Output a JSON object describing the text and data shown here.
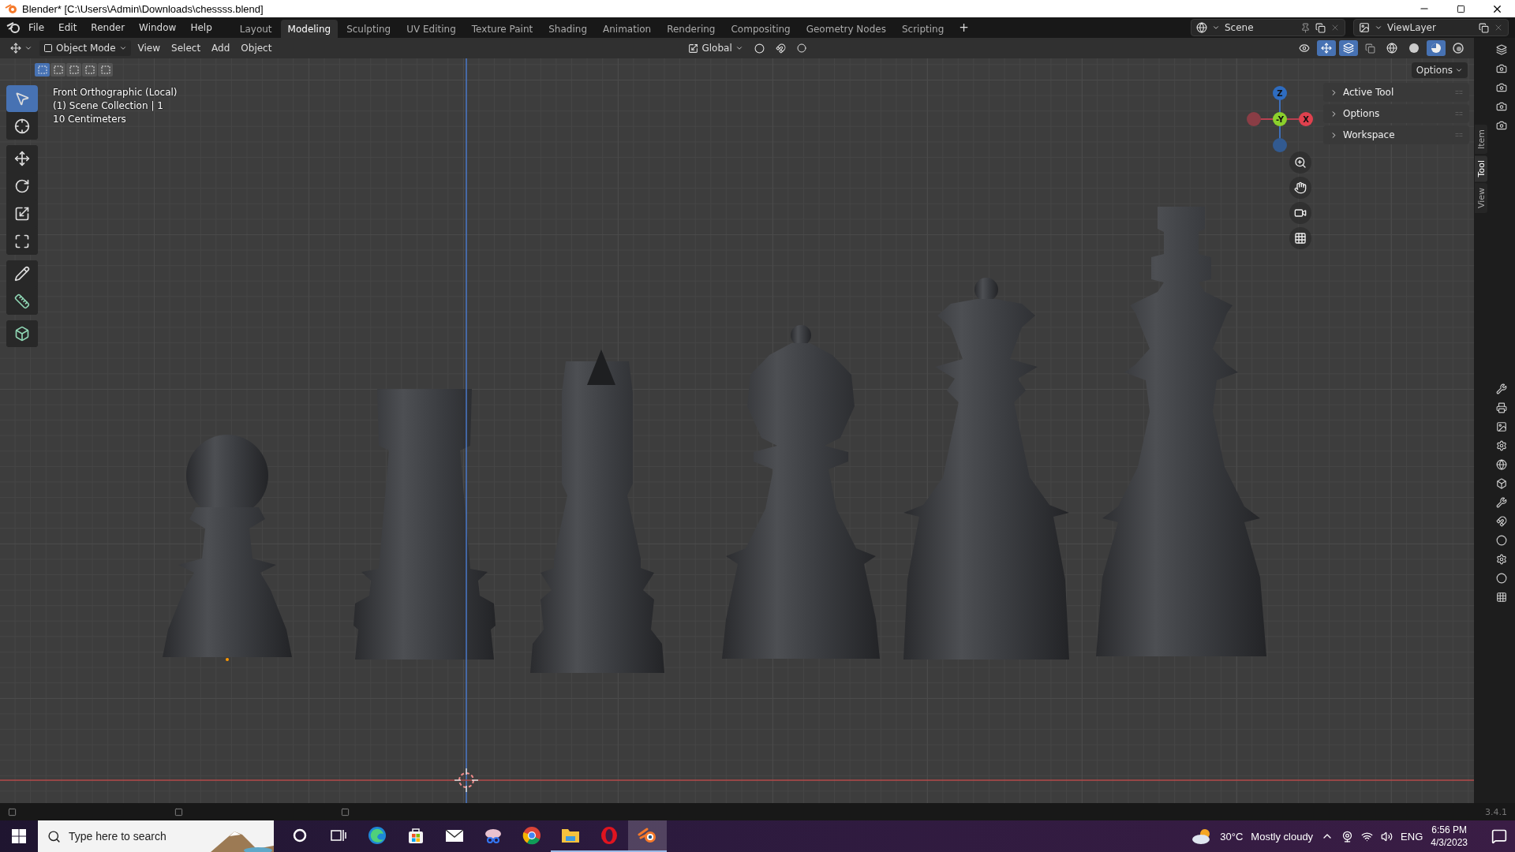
{
  "title_bar": {
    "title": "Blender* [C:\\Users\\Admin\\Downloads\\chessss.blend]"
  },
  "menu": [
    "File",
    "Edit",
    "Render",
    "Window",
    "Help"
  ],
  "workspaces": [
    {
      "label": "Layout",
      "selected": false
    },
    {
      "label": "Modeling",
      "selected": true
    },
    {
      "label": "Sculpting",
      "selected": false
    },
    {
      "label": "UV Editing",
      "selected": false
    },
    {
      "label": "Texture Paint",
      "selected": false
    },
    {
      "label": "Shading",
      "selected": false
    },
    {
      "label": "Animation",
      "selected": false
    },
    {
      "label": "Rendering",
      "selected": false
    },
    {
      "label": "Compositing",
      "selected": false
    },
    {
      "label": "Geometry Nodes",
      "selected": false
    },
    {
      "label": "Scripting",
      "selected": false
    }
  ],
  "add_workspace": "+",
  "scene": "Scene",
  "view_layer": "ViewLayer",
  "header": {
    "mode": "Object Mode",
    "menus": [
      "View",
      "Select",
      "Add",
      "Object"
    ],
    "orientation": "Global",
    "toggles": [
      {
        "kind": "gizmo",
        "on": true
      },
      {
        "kind": "overlay",
        "on": true
      },
      {
        "kind": "xray",
        "on": false
      }
    ],
    "shading": [
      {
        "kind": "wireframe",
        "selected": false
      },
      {
        "kind": "solid",
        "selected": false
      },
      {
        "kind": "material",
        "selected": true
      },
      {
        "kind": "rendered",
        "selected": false
      }
    ],
    "options": "Options"
  },
  "select_modes": [
    {
      "selected": true
    },
    {
      "selected": false
    },
    {
      "selected": false
    },
    {
      "selected": false
    },
    {
      "selected": false
    }
  ],
  "overlay_text": [
    "Front Orthographic (Local)",
    "(1) Scene Collection | 1",
    "10 Centimeters"
  ],
  "tools": [
    {
      "kind": "select",
      "selected": true
    },
    {
      "kind": "cursor",
      "selected": false
    },
    {
      "kind": "move",
      "selected": false
    },
    {
      "kind": "rotate",
      "selected": false
    },
    {
      "kind": "scale",
      "selected": false
    },
    {
      "kind": "transform",
      "selected": false
    },
    {
      "kind": "annotate",
      "selected": false
    },
    {
      "kind": "measure",
      "selected": false
    },
    {
      "kind": "add_cube",
      "selected": false
    }
  ],
  "gizmo": {
    "z": "Z",
    "y": "-Y",
    "x": "X"
  },
  "sidebar": {
    "panels": [
      "Active Tool",
      "Options",
      "Workspace"
    ],
    "tabs": [
      {
        "label": "Item",
        "selected": false
      },
      {
        "label": "Tool",
        "selected": true
      },
      {
        "label": "View",
        "selected": false
      }
    ]
  },
  "status_bar": {
    "version": "3.4.1"
  },
  "taskbar": {
    "search_placeholder": "Type here to search",
    "apps": [
      {
        "kind": "cortana",
        "running": false,
        "active": false
      },
      {
        "kind": "taskview",
        "running": false,
        "active": false
      },
      {
        "kind": "edge",
        "running": false,
        "active": false
      },
      {
        "kind": "store",
        "running": false,
        "active": false
      },
      {
        "kind": "mail",
        "running": false,
        "active": false
      },
      {
        "kind": "snip",
        "running": false,
        "active": false
      },
      {
        "kind": "chrome",
        "running": false,
        "active": false
      },
      {
        "kind": "explorer",
        "running": true,
        "active": false
      },
      {
        "kind": "opera",
        "running": true,
        "active": false
      },
      {
        "kind": "blender",
        "running": true,
        "active": true
      }
    ],
    "temperature": "30°C",
    "weather": "Mostly cloudy",
    "language": "ENG",
    "time": "6:56 PM",
    "date": "4/3/2023"
  }
}
